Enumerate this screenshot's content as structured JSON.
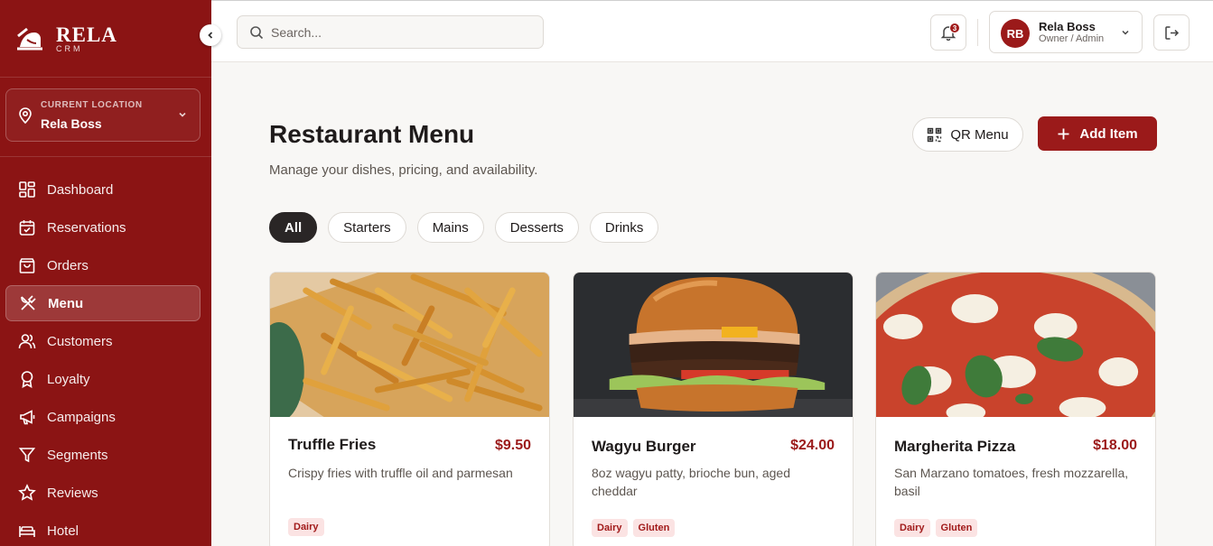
{
  "brand": {
    "name": "RELA",
    "sub": "CRM"
  },
  "location": {
    "label": "CURRENT LOCATION",
    "value": "Rela Boss"
  },
  "sidebar": {
    "items": [
      {
        "label": "Dashboard",
        "icon": "dashboard-icon"
      },
      {
        "label": "Reservations",
        "icon": "calendar-icon"
      },
      {
        "label": "Orders",
        "icon": "shopping-bag-icon"
      },
      {
        "label": "Menu",
        "icon": "utensils-icon",
        "active": true
      },
      {
        "label": "Customers",
        "icon": "users-icon"
      },
      {
        "label": "Loyalty",
        "icon": "award-icon"
      },
      {
        "label": "Campaigns",
        "icon": "megaphone-icon"
      },
      {
        "label": "Segments",
        "icon": "filter-icon"
      },
      {
        "label": "Reviews",
        "icon": "star-icon"
      },
      {
        "label": "Hotel",
        "icon": "bed-icon"
      }
    ]
  },
  "topbar": {
    "search_placeholder": "Search...",
    "notification_count": "3",
    "user": {
      "initials": "RB",
      "name": "Rela Boss",
      "role": "Owner / Admin"
    }
  },
  "page": {
    "title": "Restaurant Menu",
    "subtitle": "Manage your dishes, pricing, and availability.",
    "qr_label": "QR Menu",
    "add_label": "Add Item"
  },
  "filters": [
    "All",
    "Starters",
    "Mains",
    "Desserts",
    "Drinks"
  ],
  "active_filter": "All",
  "items": [
    {
      "name": "Truffle Fries",
      "price": "$9.50",
      "description": "Crispy fries with truffle oil and parmesan",
      "tags": [
        "Dairy"
      ],
      "image": "fries-photo"
    },
    {
      "name": "Wagyu Burger",
      "price": "$24.00",
      "description": "8oz wagyu patty, brioche bun, aged cheddar",
      "tags": [
        "Dairy",
        "Gluten"
      ],
      "image": "burger-photo"
    },
    {
      "name": "Margherita Pizza",
      "price": "$18.00",
      "description": "San Marzano tomatoes, fresh mozzarella, basil",
      "tags": [
        "Dairy",
        "Gluten"
      ],
      "image": "pizza-photo"
    }
  ],
  "colors": {
    "brand": "#8b1414",
    "accent": "#9b1a1a",
    "tag_bg": "#fbe3e3"
  }
}
